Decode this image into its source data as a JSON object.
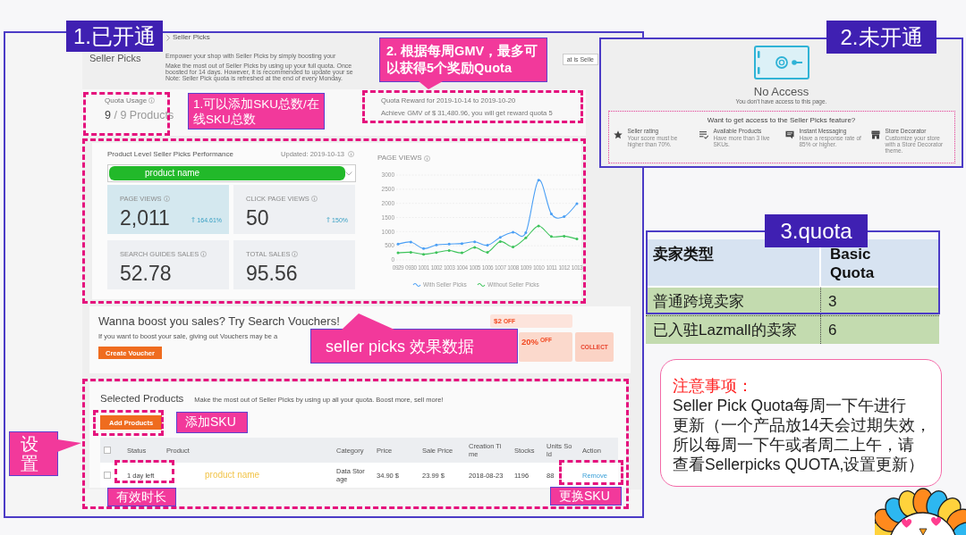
{
  "enabled_panel": {
    "label": "1.已开通",
    "breadcrumb": "Seller Picks",
    "page_title": "Seller Picks",
    "intro": [
      "Empower your shop with Seller Picks by simply boosting your",
      "Make the most out of Seller Picks by using up your full quota. Once",
      "boosted for 14 days. However, it is recommended to update your se",
      "Note: Seller Pick quota is refreshed at the end of every Monday."
    ],
    "help_button": "at is Selle",
    "quota_usage": {
      "label": "Quota Usage",
      "used": "9",
      "rest": "/ 9 Products"
    },
    "quota_reward": {
      "title": "Quota Reward for 2019-10-14 to 2019-10-20",
      "text": "Achieve GMV of $ 31,480.96, you will get reward quota 5"
    },
    "performance": {
      "title": "Product Level Seller Picks Performance",
      "updated": "Updated: 2019-10-13",
      "product_select": {
        "value": "product name"
      },
      "metrics": [
        {
          "label": "PAGE VIEWS",
          "value": "2,011",
          "change": "164.61%",
          "selected": true
        },
        {
          "label": "CLICK PAGE VIEWS",
          "value": "50",
          "change": "150%",
          "selected": false
        },
        {
          "label": "SEARCH GUIDES SALES",
          "value": "52.78",
          "selected": false
        },
        {
          "label": "TOTAL SALES",
          "value": "95.56",
          "selected": false
        }
      ],
      "chart_data": {
        "type": "line",
        "title": "PAGE VIEWS",
        "categories": [
          "0929",
          "0930",
          "1001",
          "1002",
          "1003",
          "1004",
          "1005",
          "1006",
          "1007",
          "1008",
          "1009",
          "1010",
          "1011",
          "1012",
          "1013"
        ],
        "series": [
          {
            "name": "With Seller Picks",
            "color": "#4a9ff5",
            "values": [
              560,
              630,
              400,
              530,
              560,
              580,
              640,
              520,
              800,
              980,
              960,
              2820,
              1630,
              1530,
              1990
            ]
          },
          {
            "name": "Without Seller Picks",
            "color": "#3cc35a",
            "values": [
              250,
              270,
              200,
              260,
              330,
              250,
              440,
              270,
              650,
              460,
              780,
              1200,
              830,
              840,
              740
            ]
          }
        ],
        "ylim": [
          0,
          3000
        ],
        "yticks": [
          0,
          500,
          1000,
          1500,
          2000,
          2500,
          3000
        ],
        "grid": true,
        "legend": true
      }
    },
    "voucher_promo": {
      "title": "Wanna boost you sales? Try Search Vouchers!",
      "text": "If you want to boost your sale, giving out Vouchers may be a",
      "button": "Create Voucher",
      "coupons": [
        {
          "amount": "$2",
          "unit": "OFF"
        },
        {
          "amount": "20%",
          "unit": "OFF"
        }
      ],
      "collect": "COLLECT"
    },
    "selected_products": {
      "title": "Selected Products",
      "subtitle": "Make the most out of Seller Picks by using up all your quota. Boost more, sell more!",
      "add_button": "Add Products",
      "table": {
        "header_checked": false,
        "columns": [
          "Status",
          "Product",
          "Category",
          "Price",
          "Sale Price",
          "Creation Time",
          "Stocks",
          "Units Sold",
          "Action"
        ],
        "rows": [
          {
            "checked": false,
            "cells": [
              "1 day left",
              "product name",
              "Data Storage",
              "34.90 $",
              "23.99 $",
              "2018-08-23",
              "1196",
              "88",
              "Remove"
            ]
          }
        ]
      }
    }
  },
  "callouts": [
    {
      "kind": "pointer-down",
      "text": "2. 根据每周GMV，最多可以获得5个奖励Quota"
    },
    {
      "kind": "box",
      "text": "1.可以添加SKU总数/在线SKU总数"
    },
    {
      "kind": "pointer-up",
      "text": "seller picks 效果数据"
    },
    {
      "kind": "box",
      "text": "添加SKU"
    },
    {
      "kind": "pointer-right",
      "text": "设置"
    },
    {
      "kind": "box",
      "text": "更换SKU"
    },
    {
      "kind": "box",
      "text": "有效时长"
    }
  ],
  "disabled_panel": {
    "label": "2.未开通",
    "title": "No Access",
    "subtitle": "You don't have access to this page.",
    "prompt": "Want to get access to the Seller Picks feature?",
    "requirements": [
      {
        "title": "Seller rating",
        "text": "Your score must be higher than 70%."
      },
      {
        "title": "Available Products",
        "text": "Have more than 3 live SKUs."
      },
      {
        "title": "Instant Messaging",
        "text": "Have a response rate of 85% or higher."
      },
      {
        "title": "Store Decorator",
        "text": "Customize your store with a Store Decorator theme."
      }
    ]
  },
  "quota_table": {
    "label": "3.quota",
    "columns": [
      "卖家类型",
      "Basic Quota"
    ],
    "rows": [
      [
        "普通跨境卖家",
        "3"
      ],
      [
        "已入驻Lazmall的卖家",
        "6"
      ]
    ]
  },
  "notice": {
    "title": "注意事项：",
    "lines": [
      "Seller Pick Quota每周一下午进行",
      "更新（一个产品放14天会过期失效，",
      "所以每周一下午或者周二上午，请",
      "查看Sellerpicks QUOTA,设置更新）"
    ]
  }
}
